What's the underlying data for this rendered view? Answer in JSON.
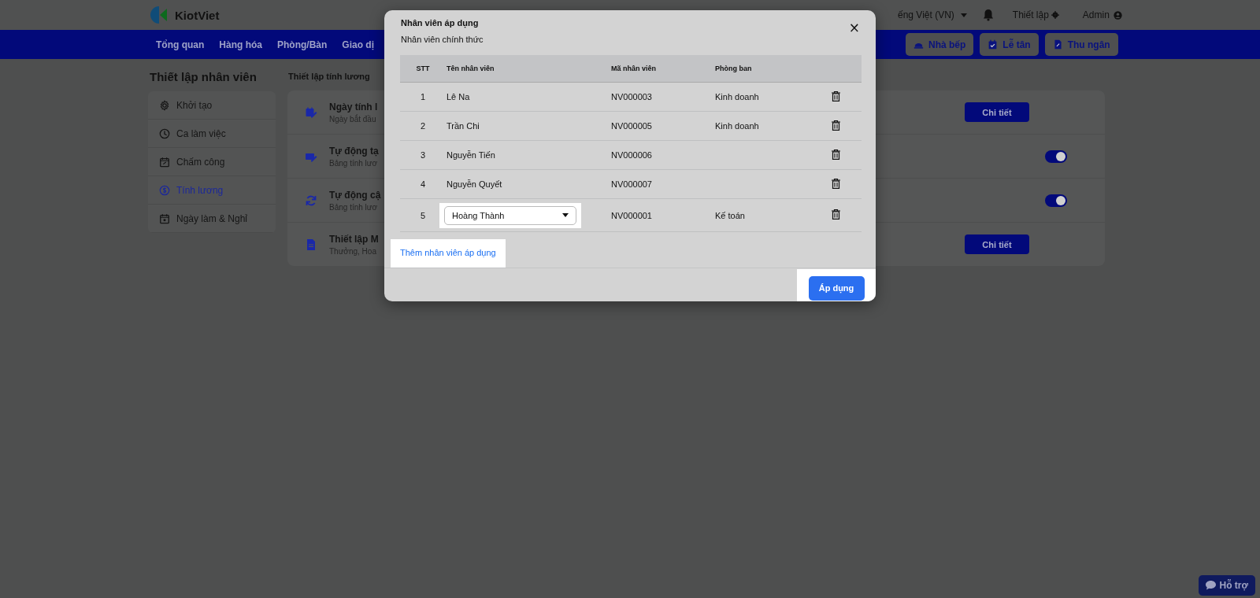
{
  "header": {
    "logo": "KiotViet",
    "language": "ếng Việt (VN)",
    "settings": "Thiết lập",
    "user": "Admin"
  },
  "nav": {
    "items": [
      {
        "label": "Tổng quan"
      },
      {
        "label": "Hàng hóa"
      },
      {
        "label": "Phòng/Bàn"
      },
      {
        "label": "Giao dị"
      }
    ],
    "actions": [
      {
        "label": "Nhà bếp",
        "kind": "kitchen"
      },
      {
        "label": "Lễ tân",
        "kind": "reception"
      },
      {
        "label": "Thu ngân",
        "kind": "cashier"
      }
    ]
  },
  "sidebar": {
    "title": "Thiết lập nhân viên",
    "items": [
      {
        "label": "Khởi tạo",
        "kind": "gear",
        "selected": false
      },
      {
        "label": "Ca làm việc",
        "kind": "clock",
        "selected": false
      },
      {
        "label": "Chấm công",
        "kind": "calendar",
        "selected": false
      },
      {
        "label": "Tính lương",
        "kind": "dollar",
        "selected": true
      },
      {
        "label": "Ngày làm & Nghỉ",
        "kind": "calendar-day",
        "selected": false
      }
    ]
  },
  "content": {
    "title": "Thiết lập tính lương",
    "rows": [
      {
        "title": "Ngày tính l",
        "subtitle": "Ngày bắt đầu",
        "kind": "button",
        "action": "Chi tiết"
      },
      {
        "title": "Tự động tạ",
        "subtitle": "Bảng tính lươ",
        "kind": "toggle",
        "on": true
      },
      {
        "title": "Tự động cậ",
        "subtitle": "Bảng tính lươ",
        "kind": "toggle",
        "on": true
      },
      {
        "title": "Thiết lập M",
        "subtitle": "Thưởng, Hoa",
        "kind": "button",
        "action": "Chi tiết"
      }
    ]
  },
  "dialog": {
    "title": "Nhân viên áp dụng",
    "subtitle": "Nhân viên chính thức",
    "close": "×",
    "columns": [
      "STT",
      "Tên nhân viên",
      "Mã nhân viên",
      "Phòng ban"
    ],
    "rows": [
      {
        "stt": "1",
        "name": "Lê Na",
        "code": "NV000003",
        "department": "Kinh doanh",
        "kind": "text"
      },
      {
        "stt": "2",
        "name": "Trần Chi",
        "code": "NV000005",
        "department": "Kinh doanh",
        "kind": "text"
      },
      {
        "stt": "3",
        "name": "Nguyễn Tiến",
        "code": "NV000006",
        "kind": "text"
      },
      {
        "stt": "4",
        "name": "Nguyễn Quyết",
        "code": "NV000007",
        "kind": "text"
      },
      {
        "stt": "5",
        "name": "Hoàng Thành",
        "code": "NV000001",
        "department": "Kế toán",
        "kind": "select",
        "highlighted": true
      }
    ],
    "add_link": {
      "label": "Thêm nhân viên áp dụng",
      "highlighted": true
    },
    "apply": {
      "label": "Áp dụng",
      "highlighted": true
    }
  },
  "help": {
    "label": "Hỗ trợ"
  }
}
